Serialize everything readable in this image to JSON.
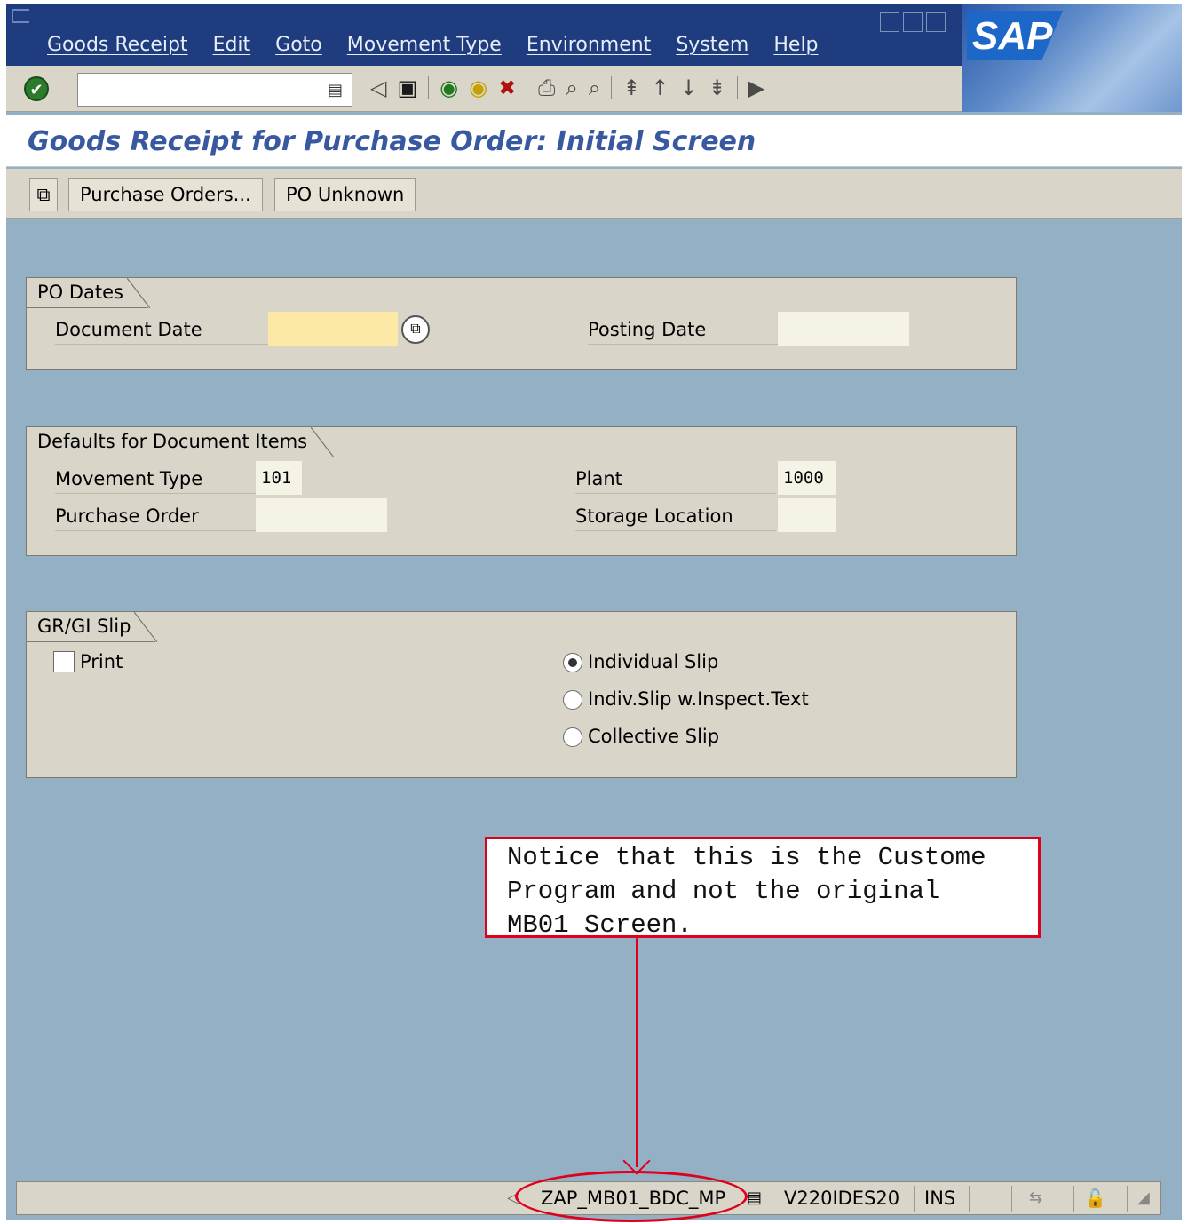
{
  "menu": {
    "items": [
      "Goods Receipt",
      "Edit",
      "Goto",
      "Movement Type",
      "Environment",
      "System",
      "Help"
    ]
  },
  "branding": {
    "logo": "SAP"
  },
  "toolbar": {
    "command_value": "",
    "icons": [
      "enter-icon",
      "command-page-icon",
      "nav-left-icon",
      "save-icon",
      "back-icon",
      "exit-icon",
      "cancel-icon",
      "print-icon",
      "find-icon",
      "find-next-icon",
      "first-page-icon",
      "prev-page-icon",
      "next-page-icon",
      "last-page-icon",
      "customize-layout-icon"
    ]
  },
  "title": "Goods Receipt for Purchase Order: Initial Screen",
  "app_toolbar": {
    "purchase_orders_label": "Purchase Orders...",
    "po_unknown_label": "PO Unknown"
  },
  "po_dates": {
    "title": "PO Dates",
    "document_date_label": "Document Date",
    "document_date_value": "",
    "posting_date_label": "Posting Date",
    "posting_date_value": ""
  },
  "defaults": {
    "title": "Defaults for Document Items",
    "movement_type_label": "Movement Type",
    "movement_type_value": "101",
    "purchase_order_label": "Purchase Order",
    "purchase_order_value": "",
    "plant_label": "Plant",
    "plant_value": "1000",
    "storage_location_label": "Storage Location",
    "storage_location_value": ""
  },
  "slip": {
    "title": "GR/GI Slip",
    "print_label": "Print",
    "print_checked": false,
    "options": [
      {
        "label": "Individual Slip",
        "selected": true
      },
      {
        "label": "Indiv.Slip w.Inspect.Text",
        "selected": false
      },
      {
        "label": "Collective Slip",
        "selected": false
      }
    ]
  },
  "annotation": {
    "text": "Notice that this is the Custome\nProgram and not the original\nMB01 Screen.",
    "color": "#e0001b"
  },
  "statusbar": {
    "program": "ZAP_MB01_BDC_MP",
    "system": "V220IDES20",
    "mode": "INS"
  }
}
